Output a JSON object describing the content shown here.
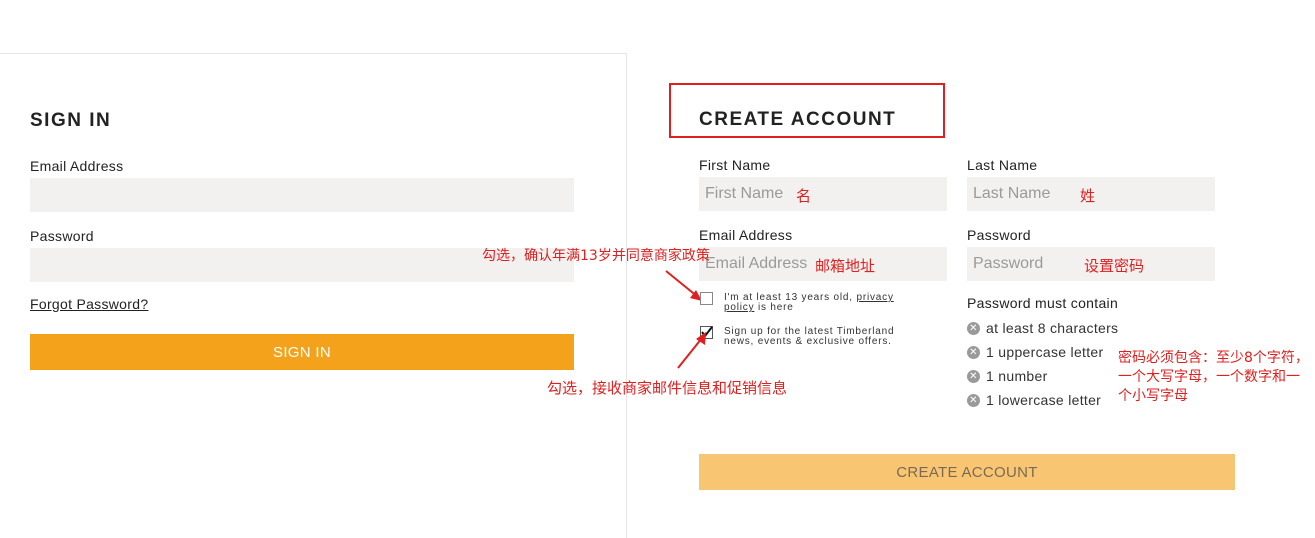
{
  "sign_in": {
    "heading": "SIGN IN",
    "email_label": "Email Address",
    "password_label": "Password",
    "forgot_link": "Forgot Password?",
    "button_label": "SIGN IN"
  },
  "create_account": {
    "heading": "CREATE ACCOUNT",
    "first_name_label": "First Name",
    "first_name_placeholder": "First Name",
    "last_name_label": "Last Name",
    "last_name_placeholder": "Last Name",
    "email_label": "Email Address",
    "email_placeholder": "Email Address",
    "password_label": "Password",
    "password_placeholder": "Password",
    "age_check_text_1": "I'm at least 13 years old,",
    "privacy_link": "privacy policy",
    "age_check_text_2": "is here",
    "age_checked": false,
    "signup_text": "Sign up for the latest Timberland news, events & exclusive offers.",
    "signup_checked": true,
    "rules_title": "Password must contain",
    "rules": [
      "at least 8 characters",
      "1 uppercase letter",
      "1 number",
      "1 lowercase letter"
    ],
    "button_label": "CREATE ACCOUNT"
  },
  "annotations": {
    "first_name": "名",
    "last_name": "姓",
    "email": "邮箱地址",
    "password": "设置密码",
    "age_check": "勾选，确认年满13岁并同意商家政策",
    "signup": "勾选，接收商家邮件信息和促销信息",
    "password_rules": "密码必须包含：至少8个字符，一个大写字母，一个数字和一个小写字母"
  },
  "colors": {
    "sign_in_button": "#f4a21c",
    "create_account_button": "#f8c572",
    "annotation": "#e02020",
    "input_bg": "#f2f1ef"
  }
}
